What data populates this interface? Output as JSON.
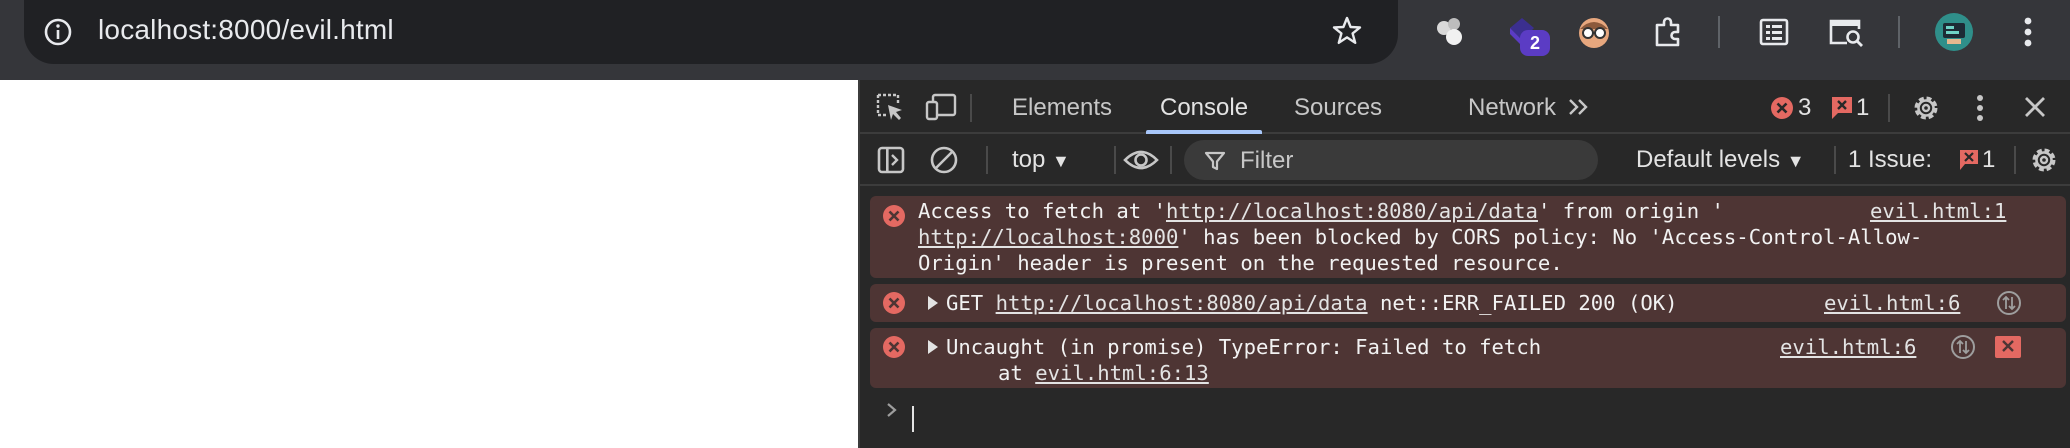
{
  "browser": {
    "url": "localhost:8000/evil.html",
    "extensions": [
      "extension-cluster-icon",
      "extension-badge-icon",
      "extension-glasses-icon",
      "extensions-puzzle-icon",
      "reading-list-icon",
      "tab-search-icon",
      "profile-avatar-icon",
      "more-menu-icon"
    ],
    "extension_badge": "2"
  },
  "devtools": {
    "tabs": [
      "Elements",
      "Console",
      "Sources",
      "Network"
    ],
    "active_tab": "Console",
    "error_count": "3",
    "issue_count": "1",
    "toolbar": {
      "context": "top",
      "filter_placeholder": "Filter",
      "levels": "Default levels",
      "issues_label": "1 Issue:",
      "issues_count": "1"
    },
    "messages": [
      {
        "line1_a": "Access to fetch at '",
        "line1_link": "http://localhost:8080/api/data",
        "line1_b": "' from origin '",
        "line2_link": "http://localhost:8000",
        "line2_b": "' has been blocked by CORS policy: No 'Access-Control-Allow-",
        "line3": "Origin' header is present on the requested resource.",
        "source": "evil.html:1"
      },
      {
        "method": "GET",
        "link": "http://localhost:8080/api/data",
        "rest": "net::ERR_FAILED 200 (OK)",
        "source": "evil.html:6"
      },
      {
        "line1": "Uncaught (in promise) TypeError: Failed to fetch",
        "line2_prefix": "at",
        "line2_link": "evil.html:6:13",
        "source": "evil.html:6"
      }
    ]
  },
  "colors": {
    "error_red": "#e46962",
    "message_bg": "#4e3534",
    "active_tab_underline": "#a8c7fa"
  }
}
